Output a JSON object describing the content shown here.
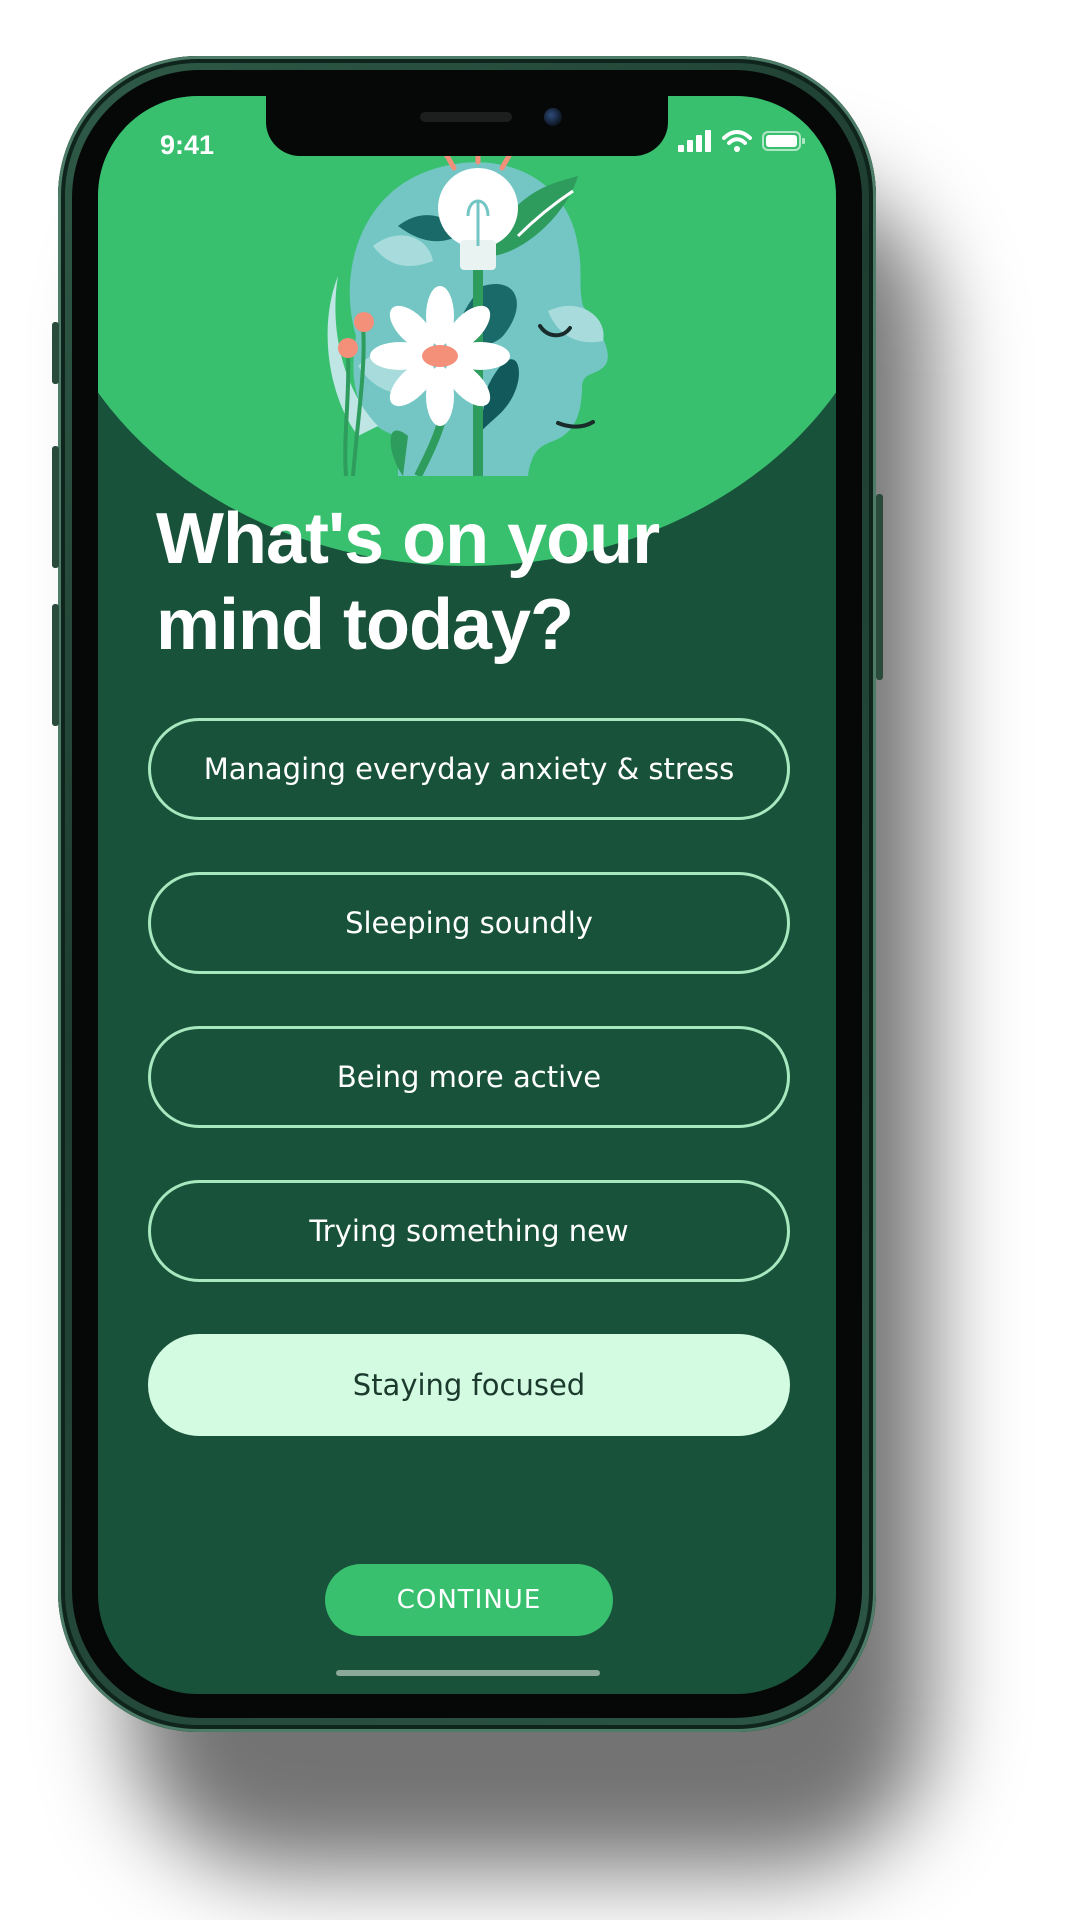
{
  "status_bar": {
    "time": "9:41",
    "icons": [
      "cellular-signal-icon",
      "wifi-icon",
      "battery-icon"
    ]
  },
  "illustration": {
    "icon": "mind-head-lightbulb-flower-illustration"
  },
  "title": "What's on your mind today?",
  "options": [
    {
      "label": "Managing everyday anxiety & stress",
      "selected": false
    },
    {
      "label": "Sleeping soundly",
      "selected": false
    },
    {
      "label": "Being more active",
      "selected": false
    },
    {
      "label": "Trying something new",
      "selected": false
    },
    {
      "label": "Staying focused",
      "selected": true
    }
  ],
  "continue_label": "CONTINUE",
  "colors": {
    "background": "#18523a",
    "accent": "#39c06f",
    "option_border": "#a8e8bf",
    "selected_fill": "#d3fbe2"
  }
}
